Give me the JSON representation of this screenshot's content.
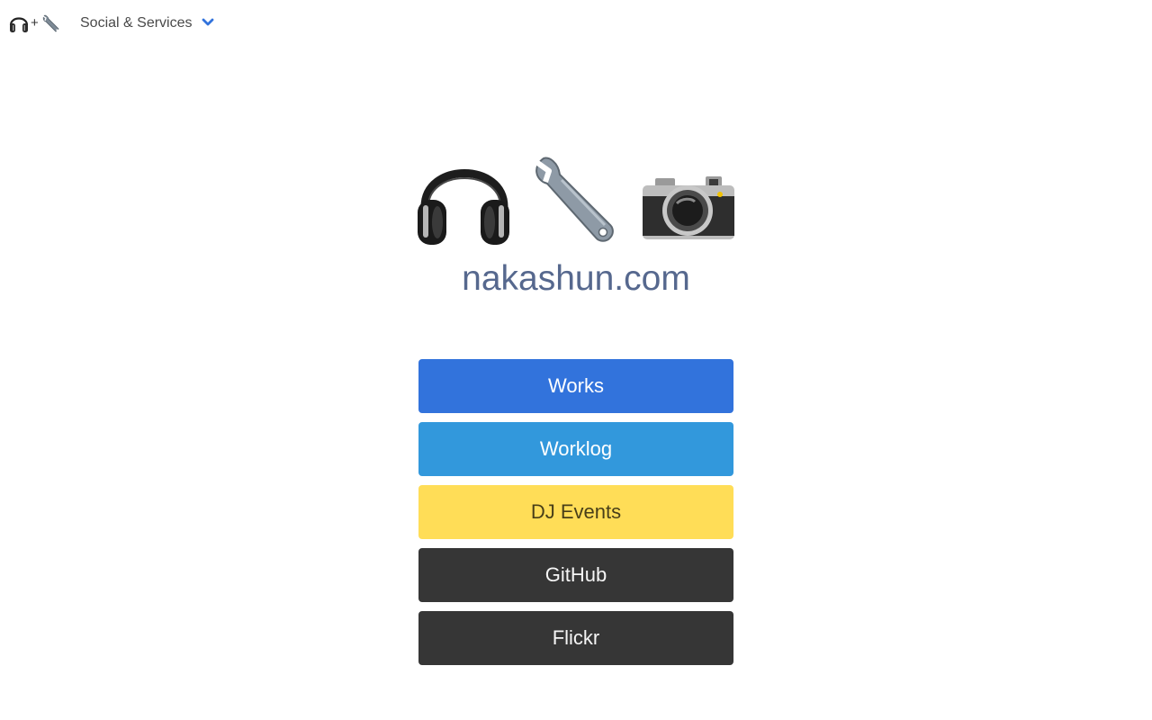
{
  "navbar": {
    "brand": {
      "icons": [
        "headphones-icon",
        "wrench-icon"
      ],
      "separator": "+"
    },
    "dropdown": {
      "label": "Social & Services",
      "icon": "chevron-down-icon"
    }
  },
  "hero": {
    "icons": [
      "headphones-icon",
      "wrench-icon",
      "camera-icon"
    ],
    "title": "nakashun.com"
  },
  "buttons": [
    {
      "label": "Works",
      "color": "#3273dc"
    },
    {
      "label": "Worklog",
      "color": "#3298dc"
    },
    {
      "label": "DJ Events",
      "color": "#ffdd57"
    },
    {
      "label": "GitHub",
      "color": "#363636"
    },
    {
      "label": "Flickr",
      "color": "#363636"
    }
  ],
  "colors": {
    "title": "#56688e",
    "accent": "#3273dc"
  }
}
